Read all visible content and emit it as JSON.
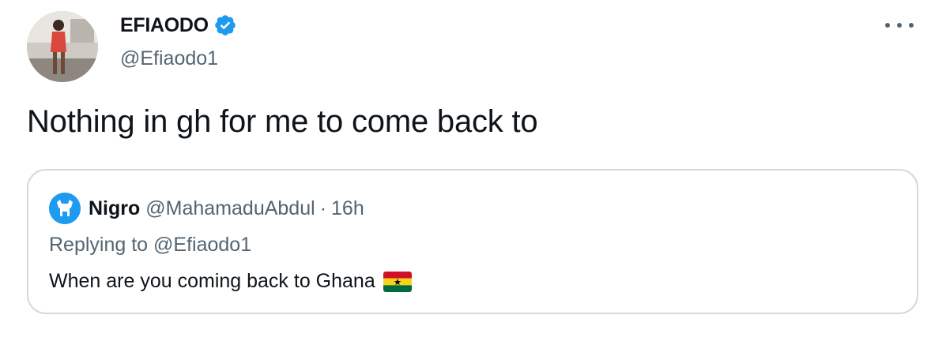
{
  "author": {
    "display_name": "EFIAODO",
    "handle": "@Efiaodo1",
    "verified_icon": "verified-badge-icon"
  },
  "tweet": {
    "text": "Nothing in gh for me to come back to"
  },
  "quoted": {
    "display_name": "Nigro",
    "handle": "@MahamaduAbdul",
    "separator": "·",
    "time": "16h",
    "replying_to": "Replying to @Efiaodo1",
    "text": "When are you coming back to Ghana",
    "emoji": "ghana-flag-icon"
  },
  "colors": {
    "accent": "#1d9bf0",
    "secondary_text": "#536471",
    "border": "#cfd9de"
  }
}
